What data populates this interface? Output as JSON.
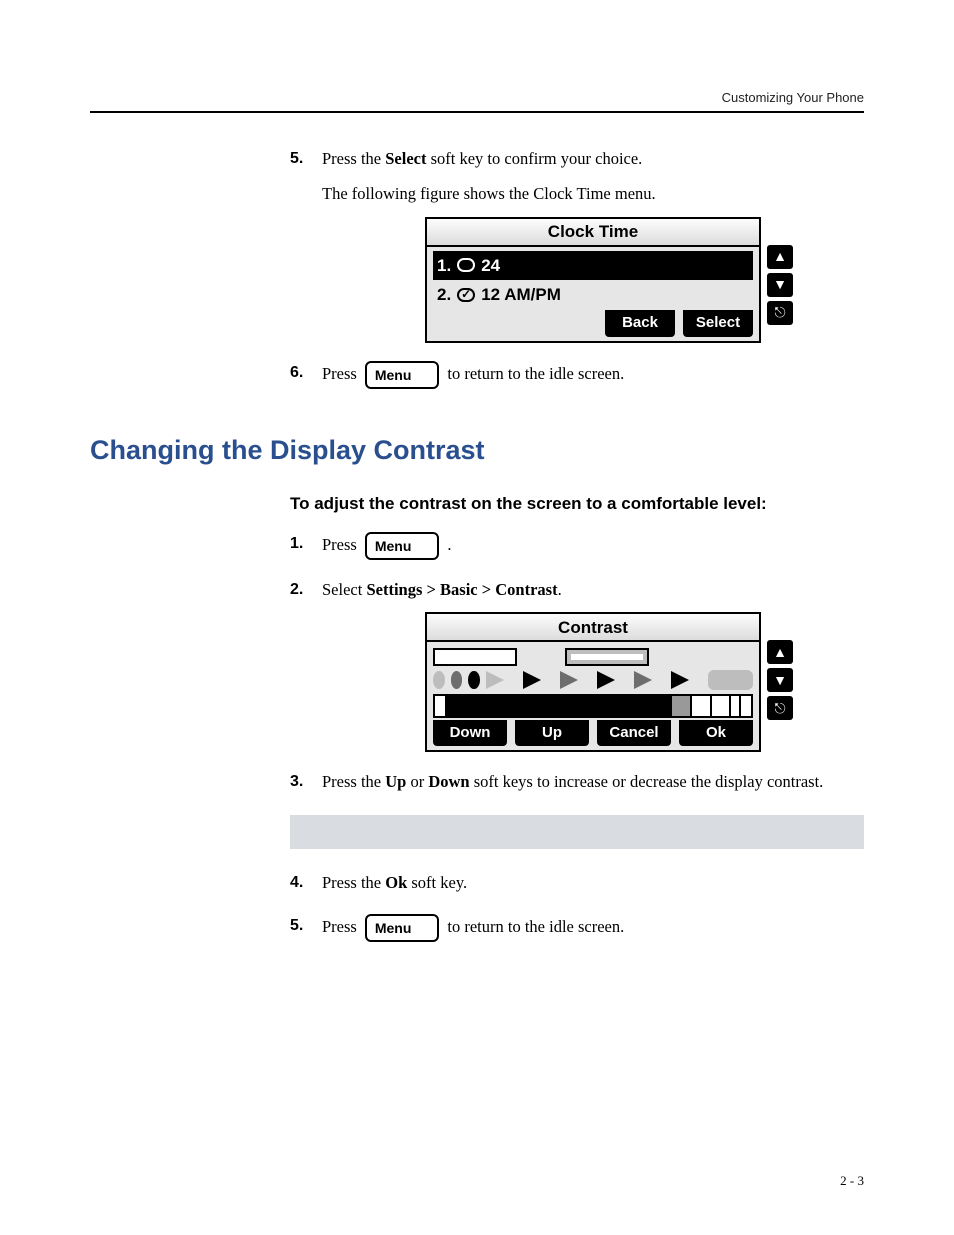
{
  "header": {
    "running": "Customizing Your Phone"
  },
  "softkeys": {
    "select": "Select",
    "back": "Back",
    "ok": "Ok",
    "down": "Down",
    "up": "Up",
    "cancel": "Cancel"
  },
  "buttons": {
    "menu": "Menu"
  },
  "steps_a": {
    "s5_num": "5.",
    "s5_a_pre": "Press the ",
    "s5_a_mid": " soft key to confirm your choice.",
    "s5_b": "The following figure shows the Clock Time menu.",
    "s6_num": "6.",
    "s6_pre": "Press ",
    "s6_post": " to return to the idle screen."
  },
  "fig_clock": {
    "title": "Clock Time",
    "opt1_num": "1.",
    "opt1_label": "24",
    "opt2_num": "2.",
    "opt2_label": "12 AM/PM"
  },
  "section": {
    "heading": "Changing the Display Contrast",
    "sub": "To adjust the contrast on the screen to a comfortable level:"
  },
  "steps_b": {
    "s1_num": "1.",
    "s1_pre": "Press ",
    "s1_post": " .",
    "s2_num": "2.",
    "s2_pre": "Select ",
    "s2_path": "Settings > Basic > Contrast",
    "s2_post": ".",
    "s3_num": "3.",
    "s3_pre": "Press the ",
    "s3_up": "Up",
    "s3_mid": " or ",
    "s3_down": "Down",
    "s3_post": " soft keys to increase or decrease the display contrast.",
    "s4_num": "4.",
    "s4_pre": "Press the ",
    "s4_post": " soft key.",
    "s5_num": "5.",
    "s5_pre": "Press ",
    "s5_post": " to return to the idle screen."
  },
  "fig_contrast": {
    "title": "Contrast"
  },
  "footer": {
    "page": "2 - 3"
  }
}
